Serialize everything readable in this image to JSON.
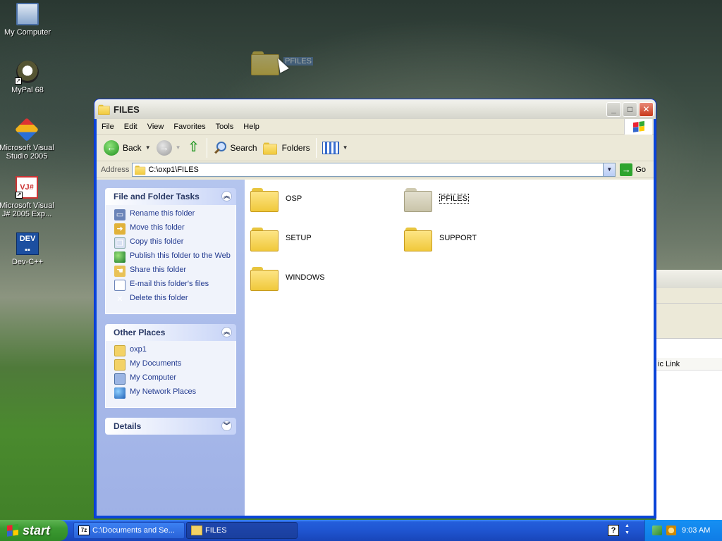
{
  "desktop": {
    "icons": [
      {
        "label": "My Computer",
        "icon": "my-computer-icon"
      },
      {
        "label": "MyPal 68",
        "icon": "mypal-icon"
      },
      {
        "label": "Microsoft Visual Studio 2005",
        "icon": "visual-studio-icon"
      },
      {
        "label": "Microsoft Visual J# 2005 Exp...",
        "icon": "visual-jsharp-icon"
      },
      {
        "label": "Dev-C++",
        "icon": "dev-cpp-icon"
      }
    ],
    "drag_ghost_label": "PFILES"
  },
  "background_window": {
    "column_fragment": "ic Link"
  },
  "window": {
    "title": "FILES",
    "controls": {
      "minimize": "_",
      "maximize": "□",
      "close": "✕"
    },
    "menu": [
      "File",
      "Edit",
      "View",
      "Favorites",
      "Tools",
      "Help"
    ],
    "toolbar": {
      "back_label": "Back",
      "search_label": "Search",
      "folders_label": "Folders"
    },
    "address": {
      "label": "Address",
      "value": "C:\\oxp1\\FILES",
      "go_label": "Go"
    },
    "sidebar": {
      "tasks": {
        "title": "File and Folder Tasks",
        "items": [
          {
            "label": "Rename this folder",
            "icon": "rename-icon"
          },
          {
            "label": "Move this folder",
            "icon": "move-icon"
          },
          {
            "label": "Copy this folder",
            "icon": "copy-icon"
          },
          {
            "label": "Publish this folder to the Web",
            "icon": "publish-web-icon"
          },
          {
            "label": "Share this folder",
            "icon": "share-icon"
          },
          {
            "label": "E-mail this folder's files",
            "icon": "email-icon"
          },
          {
            "label": "Delete this folder",
            "icon": "delete-icon"
          }
        ]
      },
      "other_places": {
        "title": "Other Places",
        "items": [
          {
            "label": "oxp1",
            "icon": "folder-icon"
          },
          {
            "label": "My Documents",
            "icon": "my-documents-icon"
          },
          {
            "label": "My Computer",
            "icon": "my-computer-icon"
          },
          {
            "label": "My Network Places",
            "icon": "network-places-icon"
          }
        ]
      },
      "details": {
        "title": "Details"
      }
    },
    "files": [
      {
        "name": "OSP",
        "state": "normal"
      },
      {
        "name": "PFILES",
        "state": "selected-faded"
      },
      {
        "name": "SETUP",
        "state": "normal"
      },
      {
        "name": "SUPPORT",
        "state": "normal"
      },
      {
        "name": "WINDOWS",
        "state": "normal"
      }
    ]
  },
  "taskbar": {
    "start_label": "start",
    "tasks": [
      {
        "label": "C:\\Documents and Se...",
        "icon": "7zip-icon",
        "active": false
      },
      {
        "label": "FILES",
        "icon": "folder-icon",
        "active": true
      }
    ],
    "clock": "9:03 AM"
  }
}
